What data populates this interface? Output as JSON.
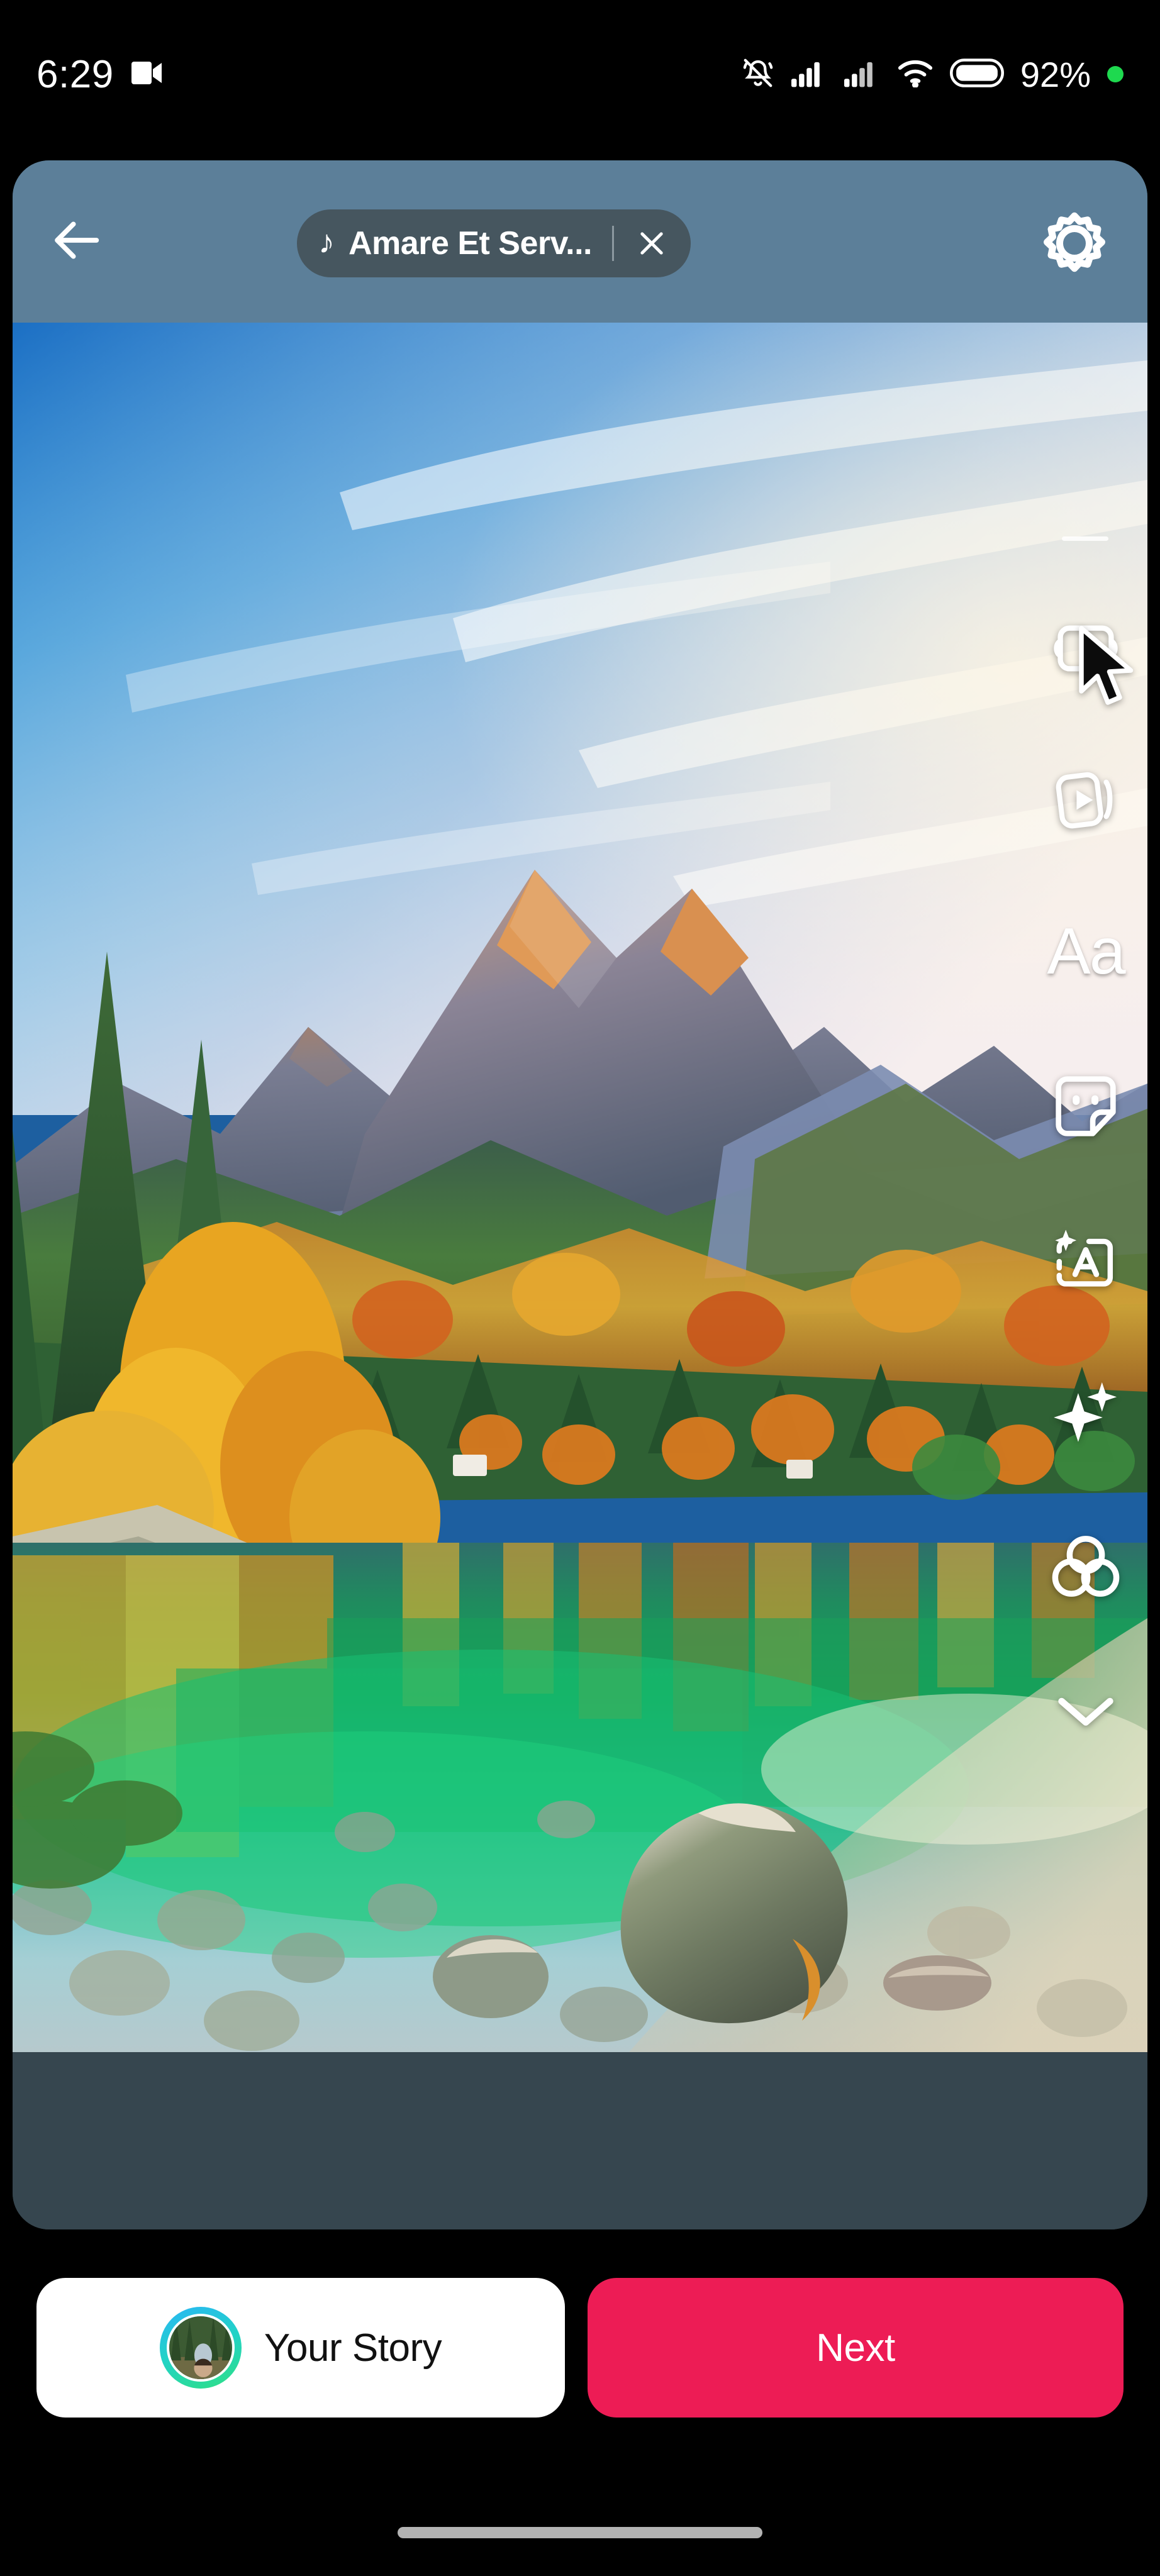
{
  "status_bar": {
    "time": "6:29",
    "battery_percent": "92%",
    "icons": [
      "video-camera-icon",
      "bell-muted-icon",
      "signal-bars-sim1-icon",
      "signal-bars-sim2-icon",
      "wifi-icon",
      "battery-icon",
      "recording-dot-icon"
    ]
  },
  "app_bar": {
    "back_icon": "back-arrow-icon",
    "music": {
      "note_icon": "music-note-icon",
      "title": "Amare Et Serv...",
      "close_icon": "close-x-icon"
    },
    "settings_icon": "gear-icon"
  },
  "tool_rail": {
    "handle": "drag-handle",
    "tools": [
      {
        "name": "music-tool",
        "icon": "music-sticker-icon",
        "label": "Music"
      },
      {
        "name": "boomerang-tool",
        "icon": "boomerang-icon",
        "label": "Boomerang"
      },
      {
        "name": "text-tool",
        "icon": "text-aa-icon",
        "label": "Aa"
      },
      {
        "name": "sticker-tool",
        "icon": "sticker-icon",
        "label": "Stickers"
      },
      {
        "name": "ai-text-tool",
        "icon": "ai-restyle-icon",
        "label": "AI"
      },
      {
        "name": "effects-tool",
        "icon": "sparkles-icon",
        "label": "Effects"
      },
      {
        "name": "filter-tool",
        "icon": "three-circles-filter-icon",
        "label": "Filters"
      },
      {
        "name": "more-tool",
        "icon": "chevron-down-icon",
        "label": "More"
      }
    ]
  },
  "canvas": {
    "media_type": "photo",
    "description": "Alpine lake with autumn forest, mountains and clear pebble water"
  },
  "actions": {
    "story": {
      "label": "Your Story",
      "avatar": "user-avatar"
    },
    "next": {
      "label": "Next"
    }
  },
  "colors": {
    "app_bar": "#5c7f99",
    "music_pill": "#46565f",
    "next_button": "#ed1c55",
    "card_background": "#36464f",
    "battery_dot": "#1ed94f"
  },
  "nav": {
    "gesture_pill": "home-indicator"
  }
}
